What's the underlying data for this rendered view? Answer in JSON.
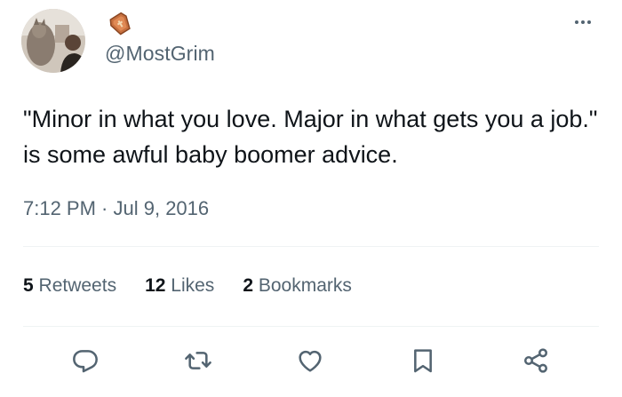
{
  "author": {
    "handle": "@MostGrim",
    "name_emoji": "coffin-emoji",
    "avatar": "user-avatar-photo"
  },
  "tweet": {
    "text": "\"Minor in what you love. Major in what gets you a job.\" is some awful baby boomer advice.",
    "time": "7:12 PM",
    "separator": " · ",
    "date": "Jul 9, 2016"
  },
  "stats": {
    "retweets": {
      "count": "5",
      "label": "Retweets"
    },
    "likes": {
      "count": "12",
      "label": "Likes"
    },
    "bookmarks": {
      "count": "2",
      "label": "Bookmarks"
    }
  },
  "actions": {
    "icons": [
      "reply-icon",
      "retweet-icon",
      "like-icon",
      "bookmark-icon",
      "share-icon"
    ],
    "icon_color": "#536471"
  },
  "colors": {
    "text_primary": "#0f1419",
    "text_secondary": "#536471",
    "divider": "#eff3f4"
  }
}
